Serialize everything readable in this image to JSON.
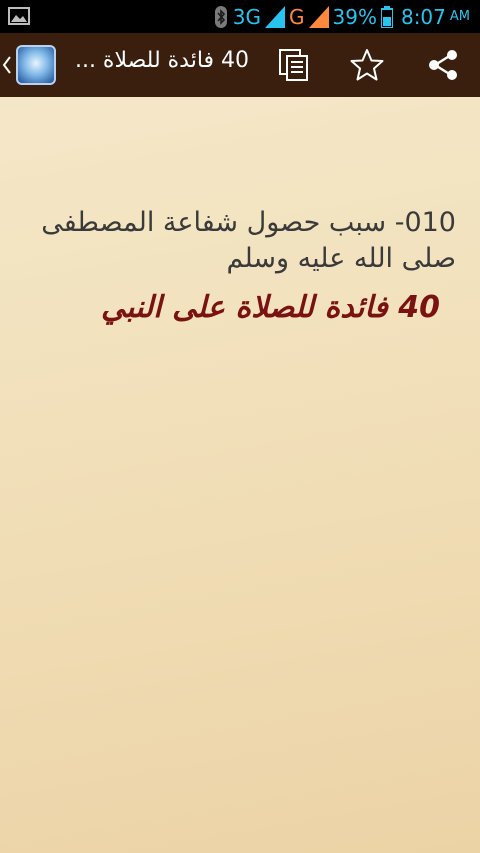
{
  "status_bar": {
    "network_3g": "3G",
    "network_g": "G",
    "battery_percent": "39%",
    "time": "8:07",
    "ampm": "AM"
  },
  "action_bar": {
    "title": "40 فائدة للصلاة ...",
    "icons": [
      "up-chevron-icon",
      "app-icon",
      "copy-icon",
      "star-icon",
      "share-icon"
    ]
  },
  "content": {
    "item_title": "010- سبب حصول شفاعة المصطفى صلى الله عليه وسلم",
    "book_title": "40 فائدة للصلاة على النبي"
  },
  "colors": {
    "action_bar": "#3a1f0f",
    "background": "#f3e2bd",
    "book_title": "#7a1212",
    "status_accent": "#29c3ef"
  }
}
